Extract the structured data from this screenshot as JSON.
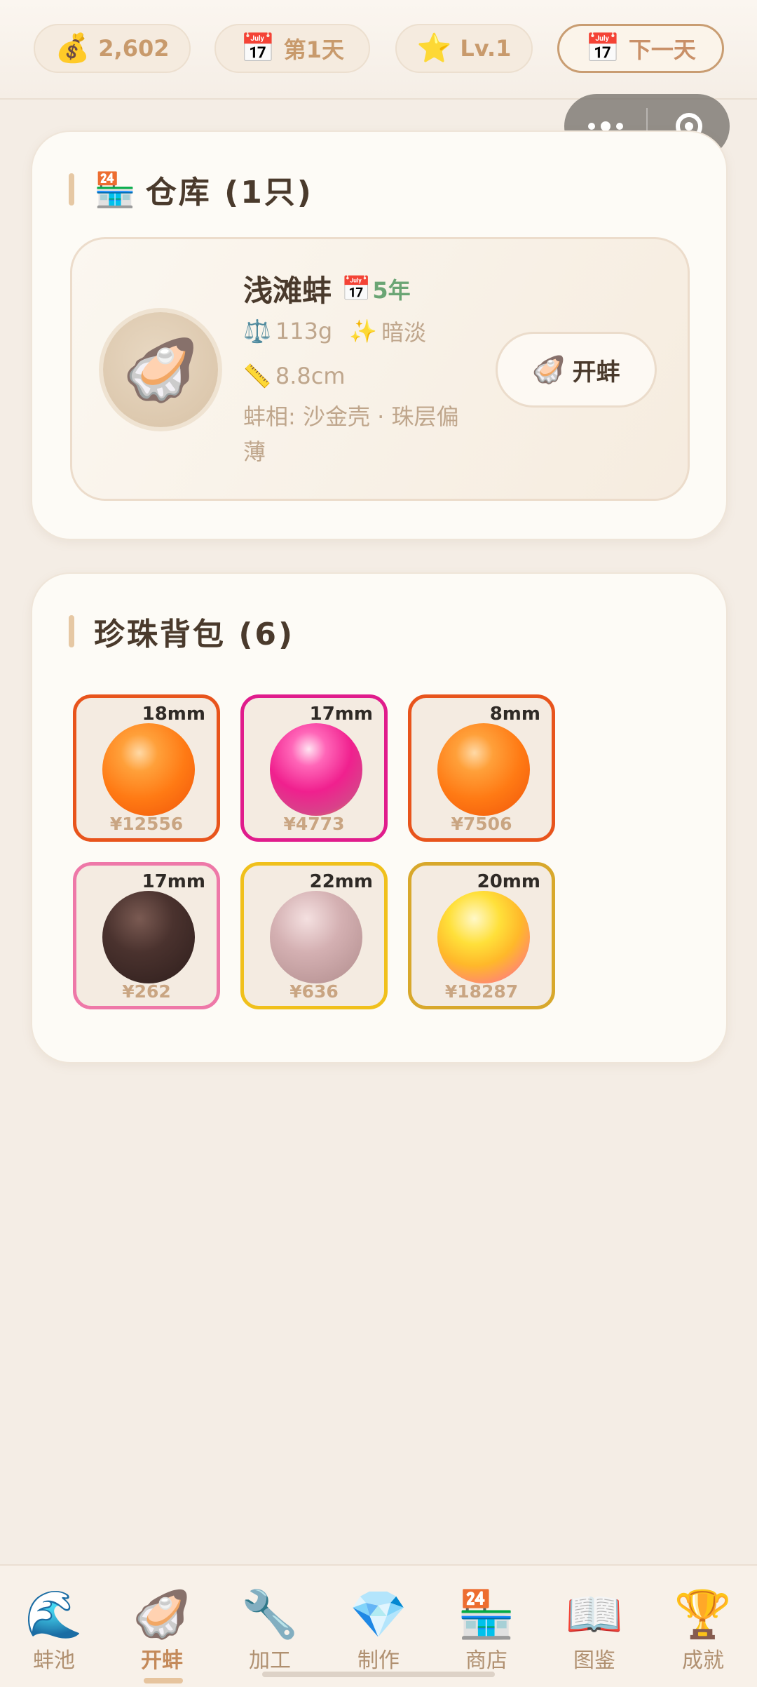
{
  "topbar": {
    "coins": {
      "icon": "money-bag-icon",
      "value": "2,602"
    },
    "day": {
      "icon": "calendar-icon",
      "label": "第1天"
    },
    "level": {
      "icon": "star-icon",
      "label": "Lv.1"
    },
    "next_day": {
      "icon": "calendar-icon",
      "label": "下一天"
    }
  },
  "warehouse": {
    "icon": "store-icon",
    "title": "仓库 (1只)",
    "clam": {
      "icon": "oyster-icon",
      "name": "浅滩蚌",
      "age": "5年",
      "weight": "113g",
      "luster": "暗淡",
      "length": "8.8cm",
      "appearance": "蚌相: 沙金壳 · 珠层偏薄",
      "open_button": "开蚌"
    }
  },
  "pearls": {
    "title": "珍珠背包 (6)",
    "items": [
      {
        "size": "18mm",
        "price": "¥12556",
        "border": "#e8541c",
        "color": "orange"
      },
      {
        "size": "17mm",
        "price": "¥4773",
        "border": "#e01c8c",
        "color": "magenta"
      },
      {
        "size": "8mm",
        "price": "¥7506",
        "border": "#e8541c",
        "color": "orange"
      },
      {
        "size": "17mm",
        "price": "¥262",
        "border": "#ee78a8",
        "color": "dark-brown"
      },
      {
        "size": "22mm",
        "price": "¥636",
        "border": "#f0c01c",
        "color": "rose-taupe"
      },
      {
        "size": "20mm",
        "price": "¥18287",
        "border": "#d8a82c",
        "color": "gold-pink"
      }
    ]
  },
  "nav": {
    "active": "开蚌",
    "items": [
      {
        "icon": "wave-icon",
        "label": "蚌池"
      },
      {
        "icon": "oyster-icon",
        "label": "开蚌"
      },
      {
        "icon": "wrench-icon",
        "label": "加工"
      },
      {
        "icon": "gem-icon",
        "label": "制作"
      },
      {
        "icon": "store-icon",
        "label": "商店"
      },
      {
        "icon": "book-icon",
        "label": "图鉴"
      },
      {
        "icon": "trophy-icon",
        "label": "成就"
      }
    ]
  }
}
